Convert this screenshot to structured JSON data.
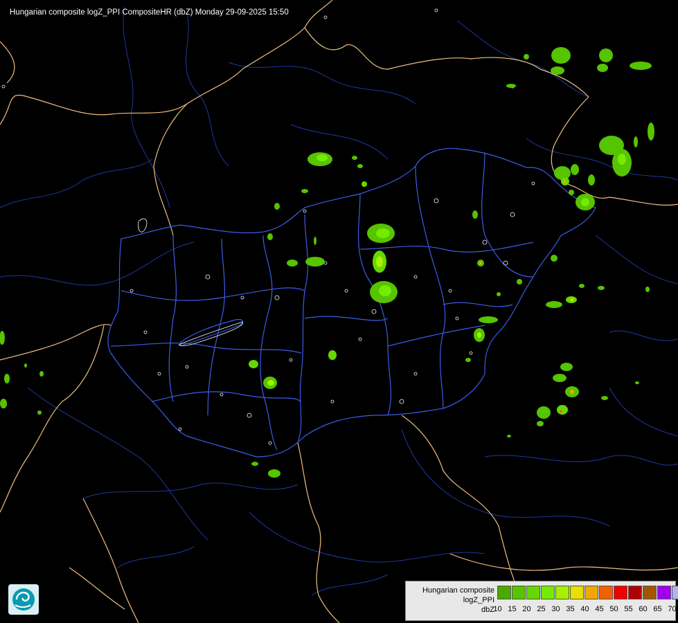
{
  "header": {
    "title": "Hungarian composite logZ_PPI CompositeHR (dbZ) Monday 29-09-2025 15:50"
  },
  "legend": {
    "line1": "Hungarian composite",
    "line2": "logZ_PPI",
    "line3": "dbZ",
    "ticks": [
      "10",
      "15",
      "20",
      "25",
      "30",
      "35",
      "40",
      "45",
      "50",
      "55",
      "60",
      "65",
      "70"
    ],
    "colors": [
      "#4aa800",
      "#56c400",
      "#64d800",
      "#74ec00",
      "#a6f000",
      "#e8e000",
      "#f0a800",
      "#f06000",
      "#f00000",
      "#b00000",
      "#a05800",
      "#a000f0",
      "#b0b0f8"
    ]
  },
  "map_colors": {
    "background": "#000000",
    "border": "#f0c080",
    "rivers": "#3050d0",
    "counties": "#4060e0",
    "coast": "#ffffff"
  },
  "logo": {
    "icon": "met-service-logo-icon"
  }
}
